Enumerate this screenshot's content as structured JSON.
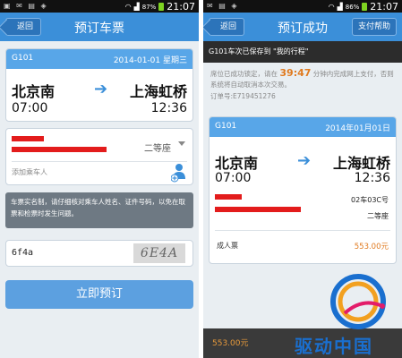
{
  "left": {
    "status": {
      "battery": "87%",
      "time": "21:07"
    },
    "back_label": "返回",
    "title": "预订车票",
    "train": {
      "number": "G101",
      "date": "2014-01-01 星期三",
      "from": "北京南",
      "to": "上海虹桥",
      "depart": "07:00",
      "arrive": "12:36"
    },
    "seat_class": "二等座",
    "add_passenger": "添加乘车人",
    "notice": "车票实名制，请仔细核对乘车人姓名、证件号码，以免在取票和检票时发生问题。",
    "captcha_value": "6f4a",
    "captcha_image_text": "6E4A",
    "submit_label": "立即预订"
  },
  "right": {
    "status": {
      "battery": "86%",
      "time": "21:07"
    },
    "back_label": "返回",
    "title": "预订成功",
    "help_label": "支付帮助",
    "saved_msg": "G101车次已保存到 \"我的行程\"",
    "msg_before": "席位已成功锁定，请在",
    "countdown": "39:47",
    "msg_after": "分钟内完成网上支付，否则系统将自动取消本次交易。",
    "order_no": "订单号:E719451276",
    "train": {
      "number": "G101",
      "date": "2014年01月01日",
      "from": "北京南",
      "to": "上海虹桥",
      "depart": "07:00",
      "arrive": "12:36"
    },
    "seat_code": "02车03C号",
    "seat_type": "二等座",
    "ticket_type": "成人票",
    "ticket_price": "553.00元",
    "total_price": "553.00元",
    "watermark": "驱动中国"
  },
  "colors": {
    "primary": "#3b8fd9",
    "card_head": "#58a6e8",
    "accent": "#e07a1f",
    "redact": "#e31c1c"
  }
}
